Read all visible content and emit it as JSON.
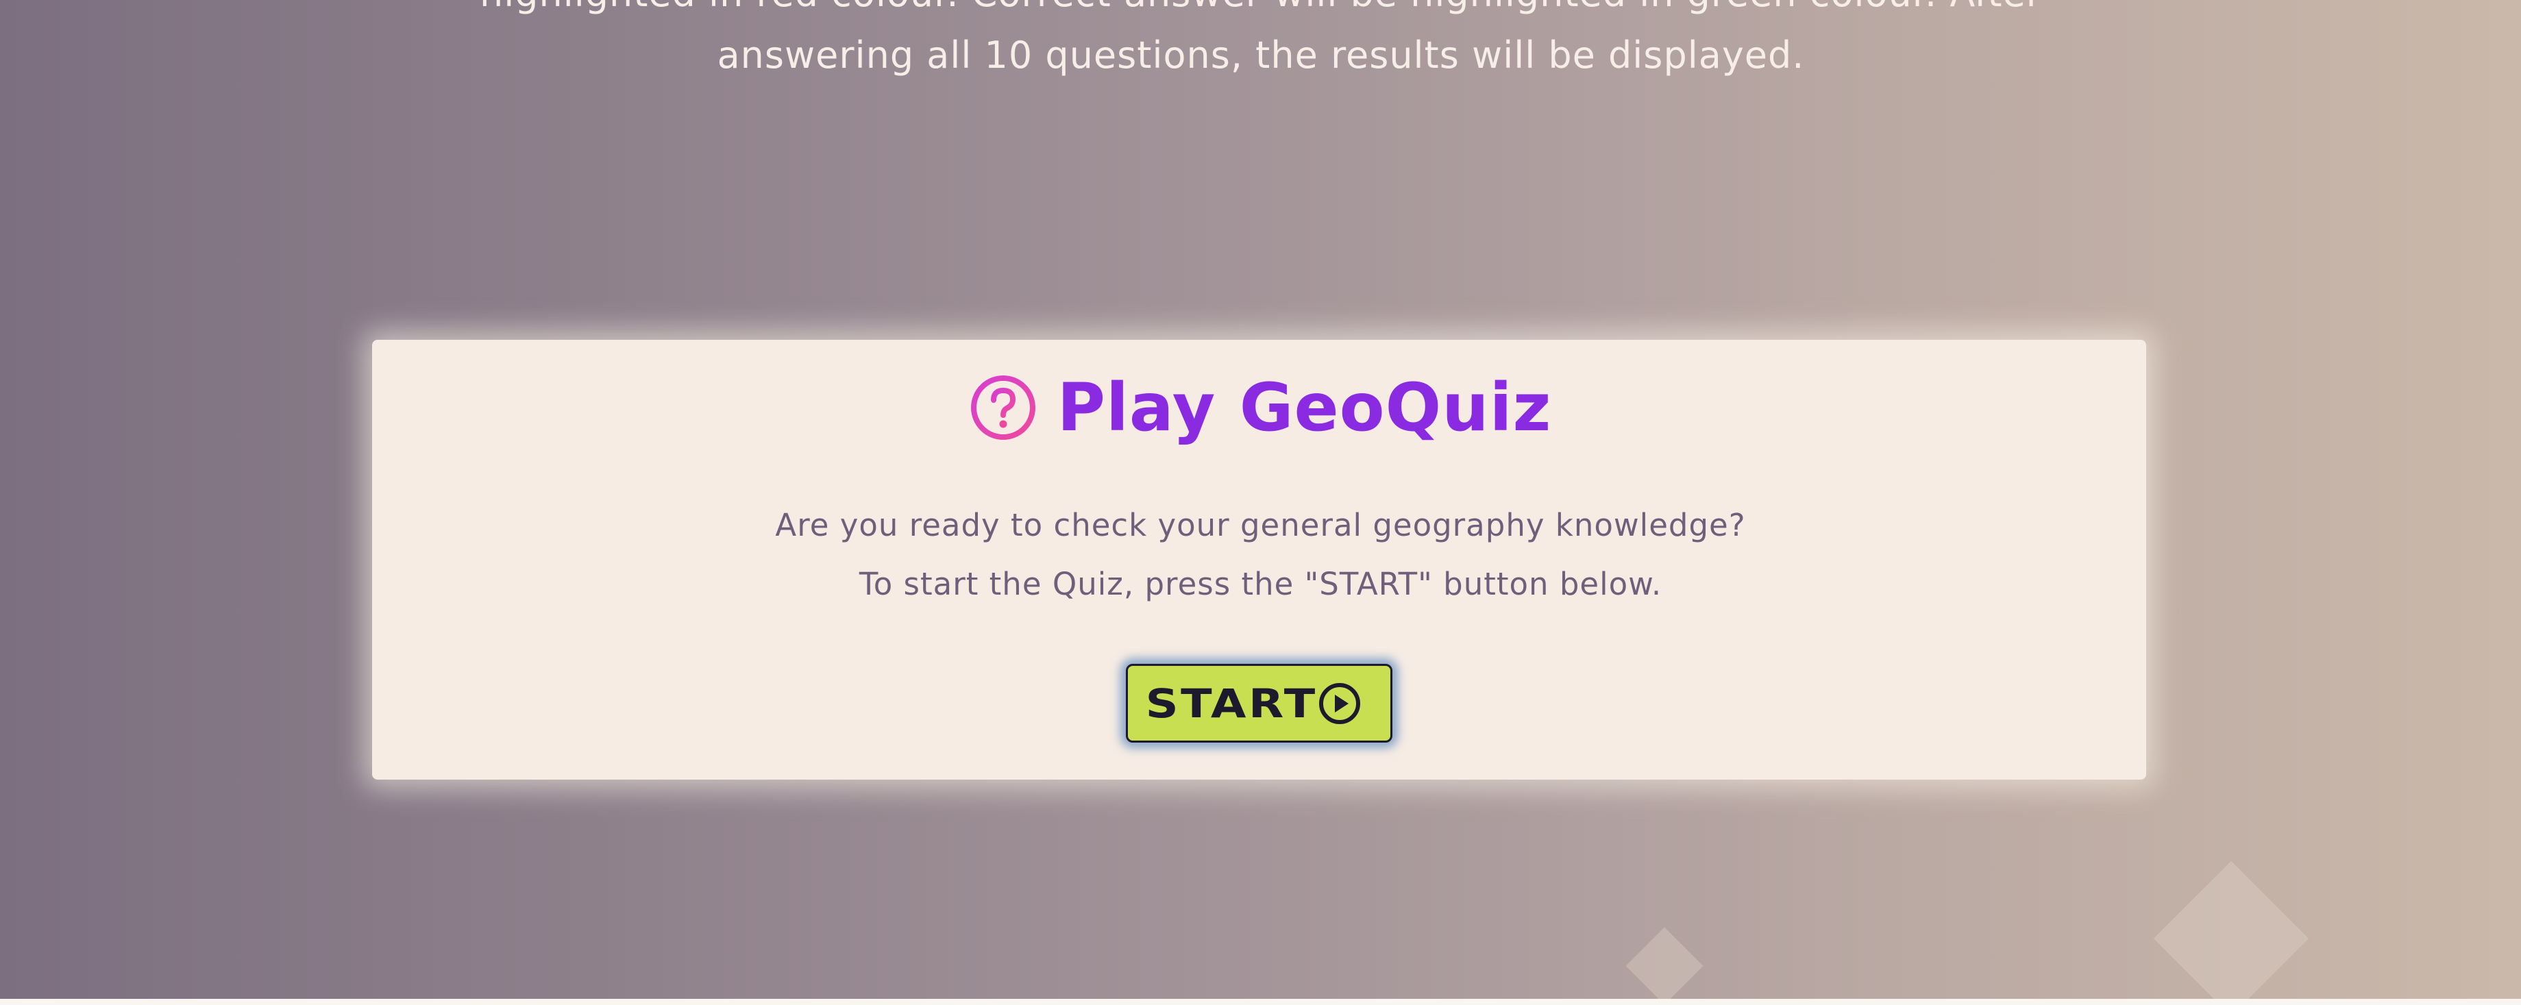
{
  "instructions": {
    "line_1": "highlighted in red colour. Correct answer will be highlighted in green colour. After",
    "line_2": "answering all 10 questions, the results will be displayed."
  },
  "quiz_card": {
    "title": "Play GeoQuiz",
    "title_icon": "question-circle-icon",
    "intro_line_1": "Are you ready to check your general geography knowledge?",
    "intro_line_2": "To start the Quiz, press the \"START\" button below.",
    "start_button": {
      "label": "START",
      "icon": "play-circle-icon"
    }
  },
  "colors": {
    "title": "#8a2be2",
    "title_icon": "#e040c8",
    "intro_text": "#6f5f7a",
    "start_button_bg": "#c9df52",
    "start_button_text": "#1e1a2e",
    "card_bg": "#f6ece4"
  }
}
